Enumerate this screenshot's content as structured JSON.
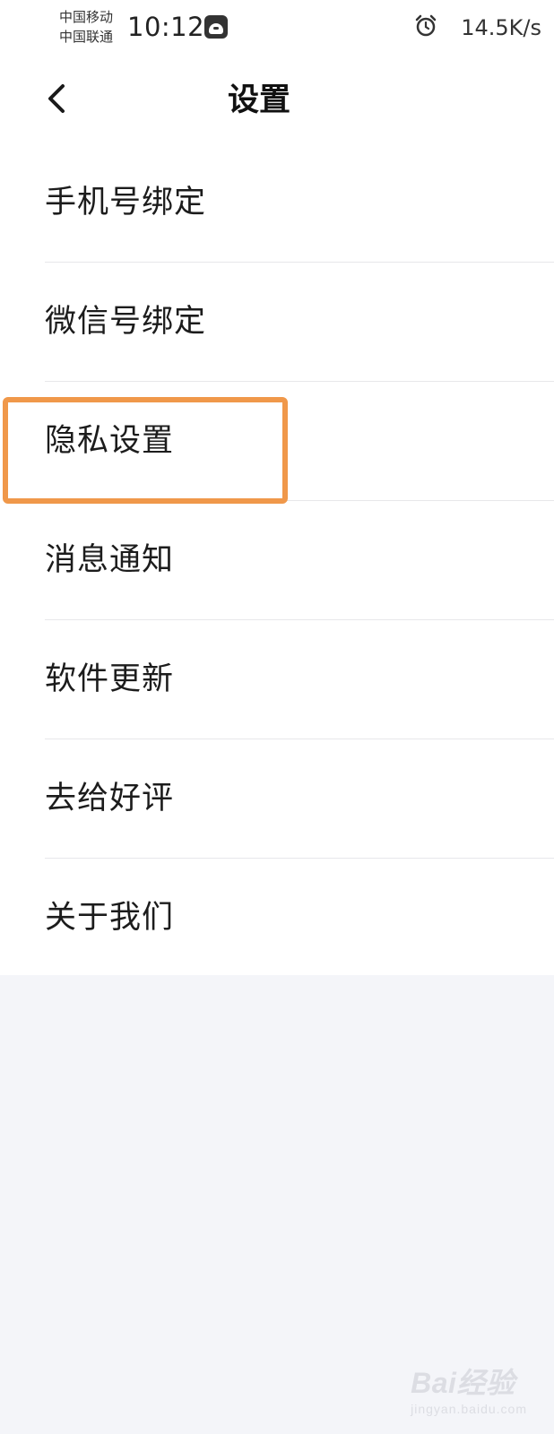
{
  "status_bar": {
    "carrier_1": "中国移动",
    "carrier_2": "中国联通",
    "time": "10:12",
    "net_speed": "14.5K/s",
    "icons": [
      "app-notification-icon",
      "alarm-clock-icon"
    ]
  },
  "header": {
    "title": "设置",
    "back_icon": "chevron-left-icon"
  },
  "menu": {
    "items": [
      {
        "label": "手机号绑定"
      },
      {
        "label": "微信号绑定"
      },
      {
        "label": "隐私设置",
        "highlighted": true
      },
      {
        "label": "消息通知"
      },
      {
        "label": "软件更新"
      },
      {
        "label": "去给好评"
      },
      {
        "label": "关于我们"
      }
    ]
  },
  "highlight_color": "#f0984a",
  "watermark": {
    "logo": "Bai经验",
    "sub": "jingyan.baidu.com"
  }
}
